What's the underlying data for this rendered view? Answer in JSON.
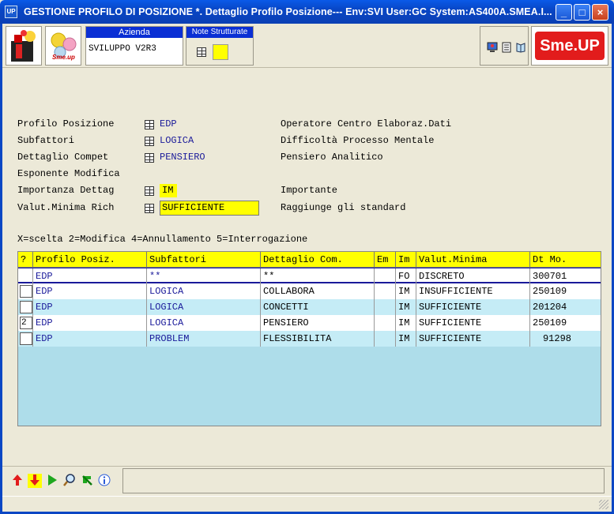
{
  "window": {
    "title": "GESTIONE PROFILO DI POSIZIONE *.  Dettaglio Profilo Posizione--- Env:SVI User:GC System:AS400A.SMEA.I...",
    "app_icon_text": "UP",
    "minimize": "_",
    "maximize": "□",
    "close": "×"
  },
  "header": {
    "azienda_label": "Azienda",
    "azienda_value": "SVILUPPO V2R3",
    "note_label": "Note Strutturate",
    "smeup_logo": "Sme.UP",
    "logo2_text": "Sme.up"
  },
  "form": {
    "fields": [
      {
        "label": "Profilo Posizione",
        "value": "EDP",
        "desc": "Operatore Centro Elaboraz.Dati"
      },
      {
        "label": "Subfattori",
        "value": "LOGICA",
        "desc": "Difficoltà Processo Mentale"
      },
      {
        "label": "Dettaglio Compet",
        "value": "PENSIERO",
        "desc": "Pensiero Analitico"
      },
      {
        "label": "Esponente Modifica",
        "value": "",
        "desc": ""
      },
      {
        "label": "Importanza Dettag",
        "value": "IM",
        "desc": "Importante"
      },
      {
        "label": "Valut.Minima Rich",
        "value": "SUFFICIENTE",
        "desc": "Raggiunge gli standard"
      }
    ]
  },
  "legend": "X=scelta  2=Modifica  4=Annullamento  5=Interrogazione",
  "table": {
    "columns": [
      "?",
      "Profilo Posiz.",
      "Subfattori",
      "Dettaglio Com.",
      "Em",
      "Im",
      "Valut.Minima",
      "Dt Mo."
    ],
    "rows": [
      {
        "sel": "",
        "profilo": "EDP",
        "sub": "**",
        "dett": "**",
        "em": "",
        "im": "FO",
        "valut": "DISCRETO",
        "dt": "300701"
      },
      {
        "sel": "",
        "profilo": "EDP",
        "sub": "LOGICA",
        "dett": "COLLABORA",
        "em": "",
        "im": "IM",
        "valut": "INSUFFICIENTE",
        "dt": "250109"
      },
      {
        "sel": "",
        "profilo": "EDP",
        "sub": "LOGICA",
        "dett": "CONCETTI",
        "em": "",
        "im": "IM",
        "valut": "SUFFICIENTE",
        "dt": "201204"
      },
      {
        "sel": "2",
        "profilo": "EDP",
        "sub": "LOGICA",
        "dett": "PENSIERO",
        "em": "",
        "im": "IM",
        "valut": "SUFFICIENTE",
        "dt": "250109"
      },
      {
        "sel": "",
        "profilo": "EDP",
        "sub": "PROBLEM",
        "dett": "FLESSIBILITA",
        "em": "",
        "im": "IM",
        "valut": "SUFFICIENTE",
        "dt": "91298"
      }
    ]
  },
  "bottom_icons": [
    "arrow-up-icon",
    "arrow-down-icon",
    "play-icon",
    "zoom-icon",
    "refresh-icon",
    "info-icon"
  ],
  "colors": {
    "header_yellow": "#ffff00",
    "table_bg": "#aeddea",
    "value_blue": "#1a1a9a",
    "brand_red": "#e21c1c"
  }
}
